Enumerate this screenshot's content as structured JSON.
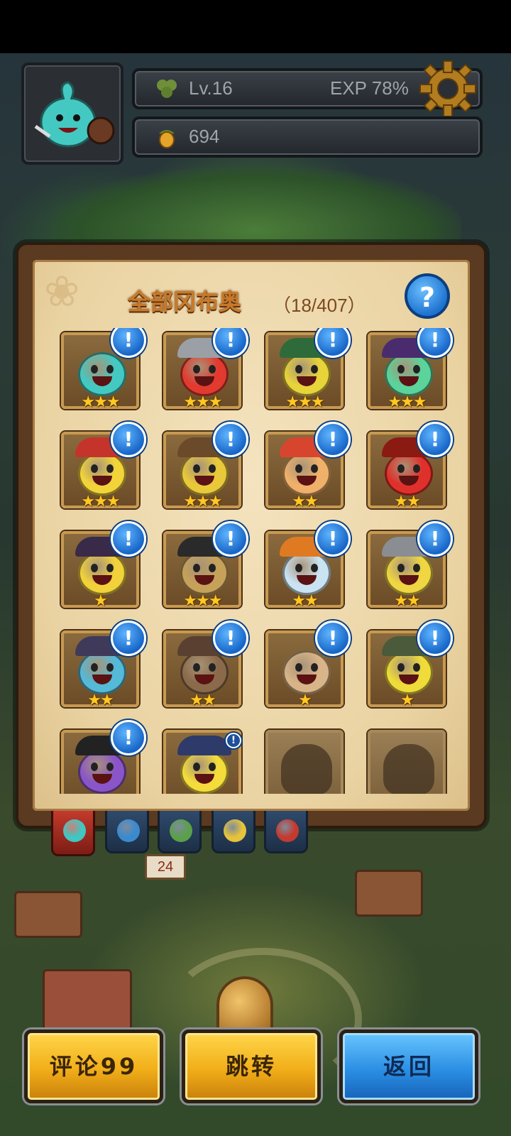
{
  "hud": {
    "level_label": "Lv.16",
    "exp_label": "EXP 78%",
    "currency_value": "694",
    "icons": [
      "clover-icon",
      "acorn-icon",
      "gear-icon"
    ]
  },
  "panel": {
    "title": "全部冈布奥",
    "count": "（18/407）",
    "help_label": "?"
  },
  "grid": {
    "badge_symbol": "!",
    "items": [
      {
        "stars": "★★★",
        "color": "#43c9c2",
        "hat": "",
        "badge": true,
        "locked": false
      },
      {
        "stars": "★★★",
        "color": "#e23a2f",
        "hat": "#9aa0a6",
        "badge": true,
        "locked": false
      },
      {
        "stars": "★★★",
        "color": "#e7d33a",
        "hat": "#2f6b3a",
        "badge": true,
        "locked": false
      },
      {
        "stars": "★★★",
        "color": "#5bd39a",
        "hat": "#4a2c6e",
        "badge": true,
        "locked": false
      },
      {
        "stars": "★★★",
        "color": "#f2d43a",
        "hat": "#c5342a",
        "badge": true,
        "locked": false
      },
      {
        "stars": "★★★",
        "color": "#e9c93a",
        "hat": "#6b4a2a",
        "badge": true,
        "locked": false
      },
      {
        "stars": "★★",
        "color": "#efb06a",
        "hat": "#d8452f",
        "badge": true,
        "locked": false
      },
      {
        "stars": "★★",
        "color": "#e0302b",
        "hat": "#8a1a12",
        "badge": true,
        "locked": false
      },
      {
        "stars": "★",
        "color": "#f1d23b",
        "hat": "#3a2a4a",
        "badge": true,
        "locked": false
      },
      {
        "stars": "★★★",
        "color": "#c6a15a",
        "hat": "#2a2a2a",
        "badge": true,
        "locked": false
      },
      {
        "stars": "★★",
        "color": "#c9e3f2",
        "hat": "#e07a22",
        "badge": true,
        "locked": false
      },
      {
        "stars": "★★",
        "color": "#efd642",
        "hat": "#8a8e92",
        "badge": true,
        "locked": false
      },
      {
        "stars": "★★",
        "color": "#55b9d8",
        "hat": "#3f3a5a",
        "badge": true,
        "locked": false
      },
      {
        "stars": "★★",
        "color": "#8a6a4a",
        "hat": "#5a4030",
        "badge": true,
        "locked": false
      },
      {
        "stars": "★",
        "color": "#d8b488",
        "hat": "",
        "badge": true,
        "locked": false
      },
      {
        "stars": "★",
        "color": "#efdc3a",
        "hat": "#4a5a3a",
        "badge": true,
        "locked": false
      },
      {
        "stars": "",
        "color": "#8a55c9",
        "hat": "#222222",
        "badge": true,
        "locked": false
      },
      {
        "stars": "",
        "color": "#f3dc3b",
        "hat": "#2d3a6a",
        "badge": "small",
        "locked": false
      },
      {
        "stars": "",
        "color": "",
        "hat": "",
        "badge": false,
        "locked": true
      },
      {
        "stars": "",
        "color": "",
        "hat": "",
        "badge": false,
        "locked": true
      }
    ]
  },
  "tabs": [
    {
      "name": "all",
      "color": "#3fc7c2",
      "active": true
    },
    {
      "name": "blue",
      "color": "#3a8ad0",
      "active": false
    },
    {
      "name": "green",
      "color": "#5aa04a",
      "active": false
    },
    {
      "name": "yellow",
      "color": "#e6c33a",
      "active": false
    },
    {
      "name": "red",
      "color": "#c43a2f",
      "active": false
    }
  ],
  "map_sign": "24",
  "buttons": {
    "comment": "评论99",
    "jump": "跳转",
    "back": "返回"
  }
}
